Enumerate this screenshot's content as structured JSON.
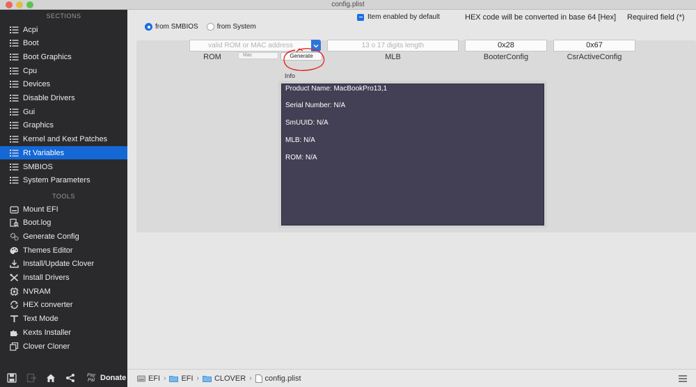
{
  "window": {
    "title": "config.plist"
  },
  "sidebar": {
    "sections_heading": "SECTIONS",
    "sections": [
      {
        "label": "Acpi",
        "icon": "list-icon"
      },
      {
        "label": "Boot",
        "icon": "list-icon"
      },
      {
        "label": "Boot Graphics",
        "icon": "list-icon"
      },
      {
        "label": "Cpu",
        "icon": "list-icon"
      },
      {
        "label": "Devices",
        "icon": "list-icon"
      },
      {
        "label": "Disable Drivers",
        "icon": "list-icon"
      },
      {
        "label": "Gui",
        "icon": "list-icon"
      },
      {
        "label": "Graphics",
        "icon": "list-icon"
      },
      {
        "label": "Kernel and Kext Patches",
        "icon": "list-icon"
      },
      {
        "label": "Rt Variables",
        "icon": "list-icon",
        "active": true
      },
      {
        "label": "SMBIOS",
        "icon": "list-icon"
      },
      {
        "label": "System Parameters",
        "icon": "list-icon"
      }
    ],
    "tools_heading": "TOOLS",
    "tools": [
      {
        "label": "Mount EFI",
        "icon": "disk-icon"
      },
      {
        "label": "Boot.log",
        "icon": "log-icon"
      },
      {
        "label": "Generate Config",
        "icon": "gears-icon"
      },
      {
        "label": "Themes Editor",
        "icon": "palette-icon"
      },
      {
        "label": "Install/Update Clover",
        "icon": "download-icon"
      },
      {
        "label": "Install Drivers",
        "icon": "tools-icon"
      },
      {
        "label": "NVRAM",
        "icon": "chip-icon"
      },
      {
        "label": "HEX converter",
        "icon": "convert-icon"
      },
      {
        "label": "Text Mode",
        "icon": "text-icon"
      },
      {
        "label": "Kexts Installer",
        "icon": "puzzle-icon"
      },
      {
        "label": "Clover Cloner",
        "icon": "clone-icon"
      }
    ],
    "bottom": {
      "paypal_line1": "Pay",
      "paypal_line2": "Pal",
      "donate_label": "Donate"
    }
  },
  "header": {
    "item_enabled_label": "Item enabled by default",
    "hex_note": "HEX code will be converted in base 64 [Hex]",
    "required_note": "Required field (*)"
  },
  "source": {
    "options": [
      "from SMBIOS",
      "from System"
    ],
    "selected": "from SMBIOS"
  },
  "fields": {
    "rom": {
      "label": "ROM",
      "placeholder": "valid ROM or MAC address",
      "value": ""
    },
    "rom_mode": "Mac",
    "generate_label": "Generate",
    "mlb": {
      "label": "MLB",
      "placeholder": "13 o 17 digits length",
      "value": ""
    },
    "booter_config": {
      "label": "BooterConfig",
      "value": "0x28"
    },
    "csr_active_config": {
      "label": "CsrActiveConfig",
      "value": "0x67"
    }
  },
  "info": {
    "label": "Info",
    "lines": [
      "Product Name: MacBookPro13,1",
      "Serial Number: N/A",
      "SmUUID: N/A",
      "MLB: N/A",
      "ROM: N/A"
    ]
  },
  "pathbar": {
    "crumbs": [
      "EFI",
      "EFI",
      "CLOVER",
      "config.plist"
    ]
  },
  "colors": {
    "accent": "#1468d6",
    "sidebar_bg": "#2a2a2c",
    "info_bg": "#434055",
    "annotation": "#e0261f"
  }
}
